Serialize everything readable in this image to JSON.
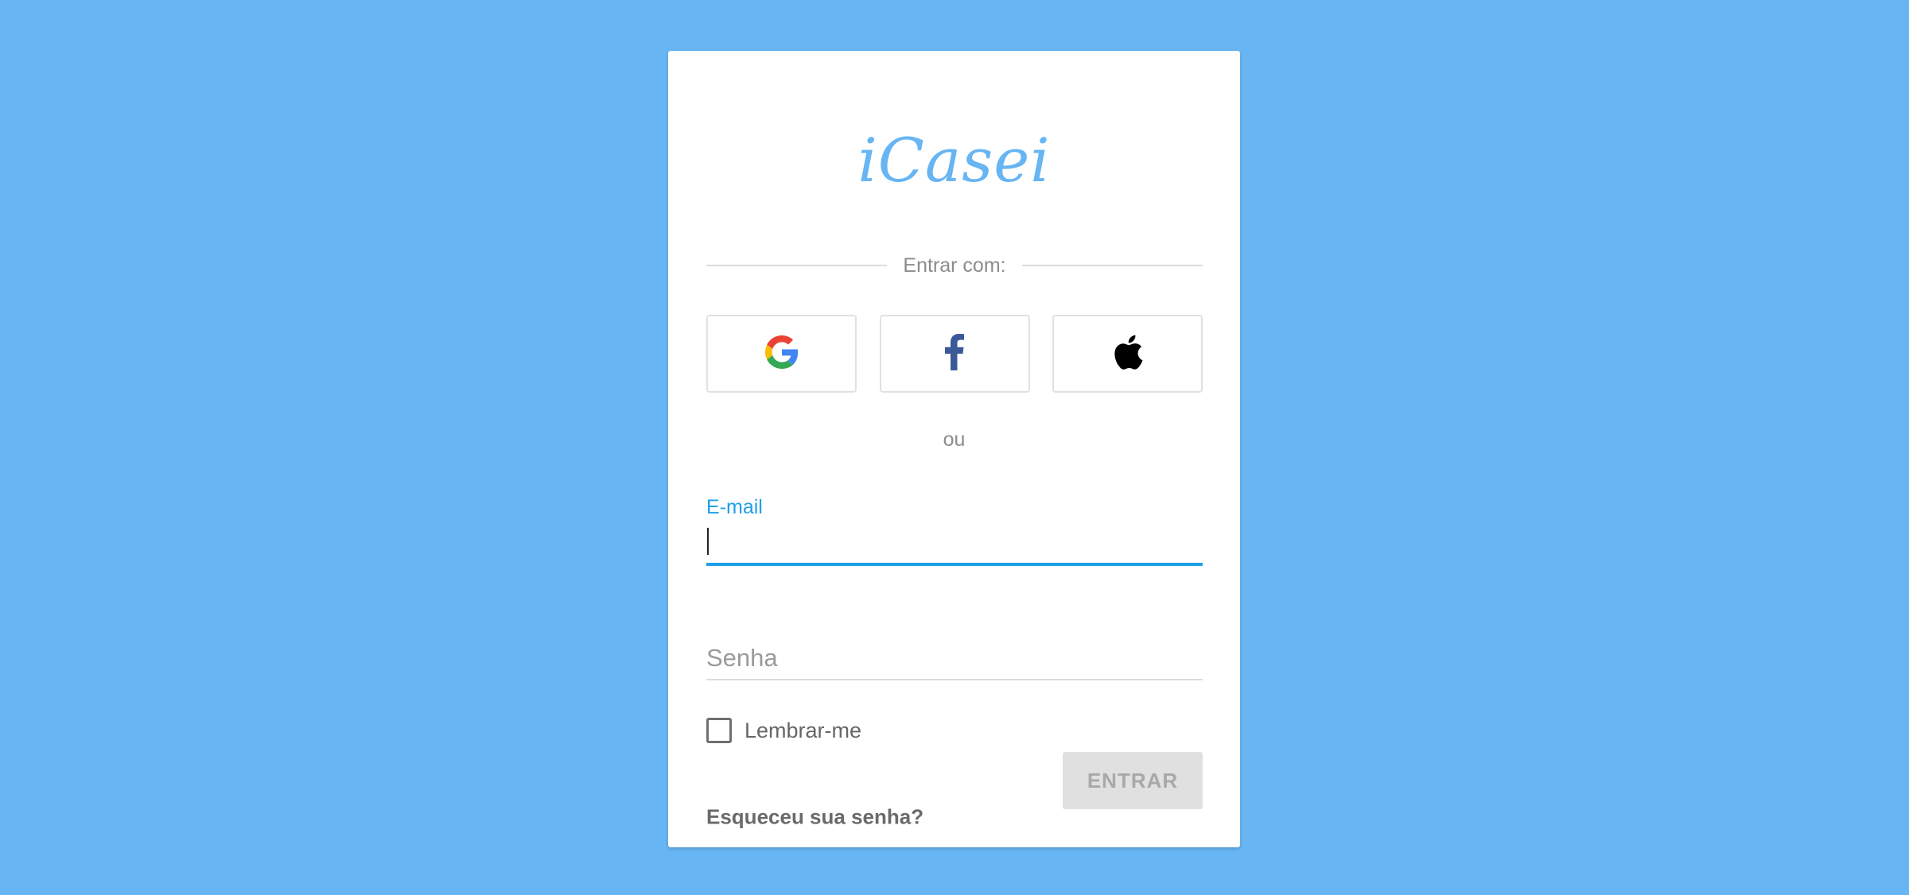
{
  "brand": {
    "logo_text": "iCasei",
    "color": "#67b5f3"
  },
  "social": {
    "divider_text": "Entrar com:",
    "buttons": [
      {
        "provider": "google",
        "icon": "google-icon"
      },
      {
        "provider": "facebook",
        "icon": "facebook-icon"
      },
      {
        "provider": "apple",
        "icon": "apple-icon"
      }
    ]
  },
  "or_text": "ou",
  "form": {
    "email_label": "E-mail",
    "email_value": "",
    "password_placeholder": "Senha",
    "password_value": "",
    "remember_label": "Lembrar-me",
    "remember_checked": false,
    "forgot_link": "Esqueceu sua senha?",
    "submit_label": "ENTRAR"
  },
  "colors": {
    "background": "#67b5f3",
    "focus_accent": "#1ea0e6",
    "facebook": "#3b5998"
  }
}
